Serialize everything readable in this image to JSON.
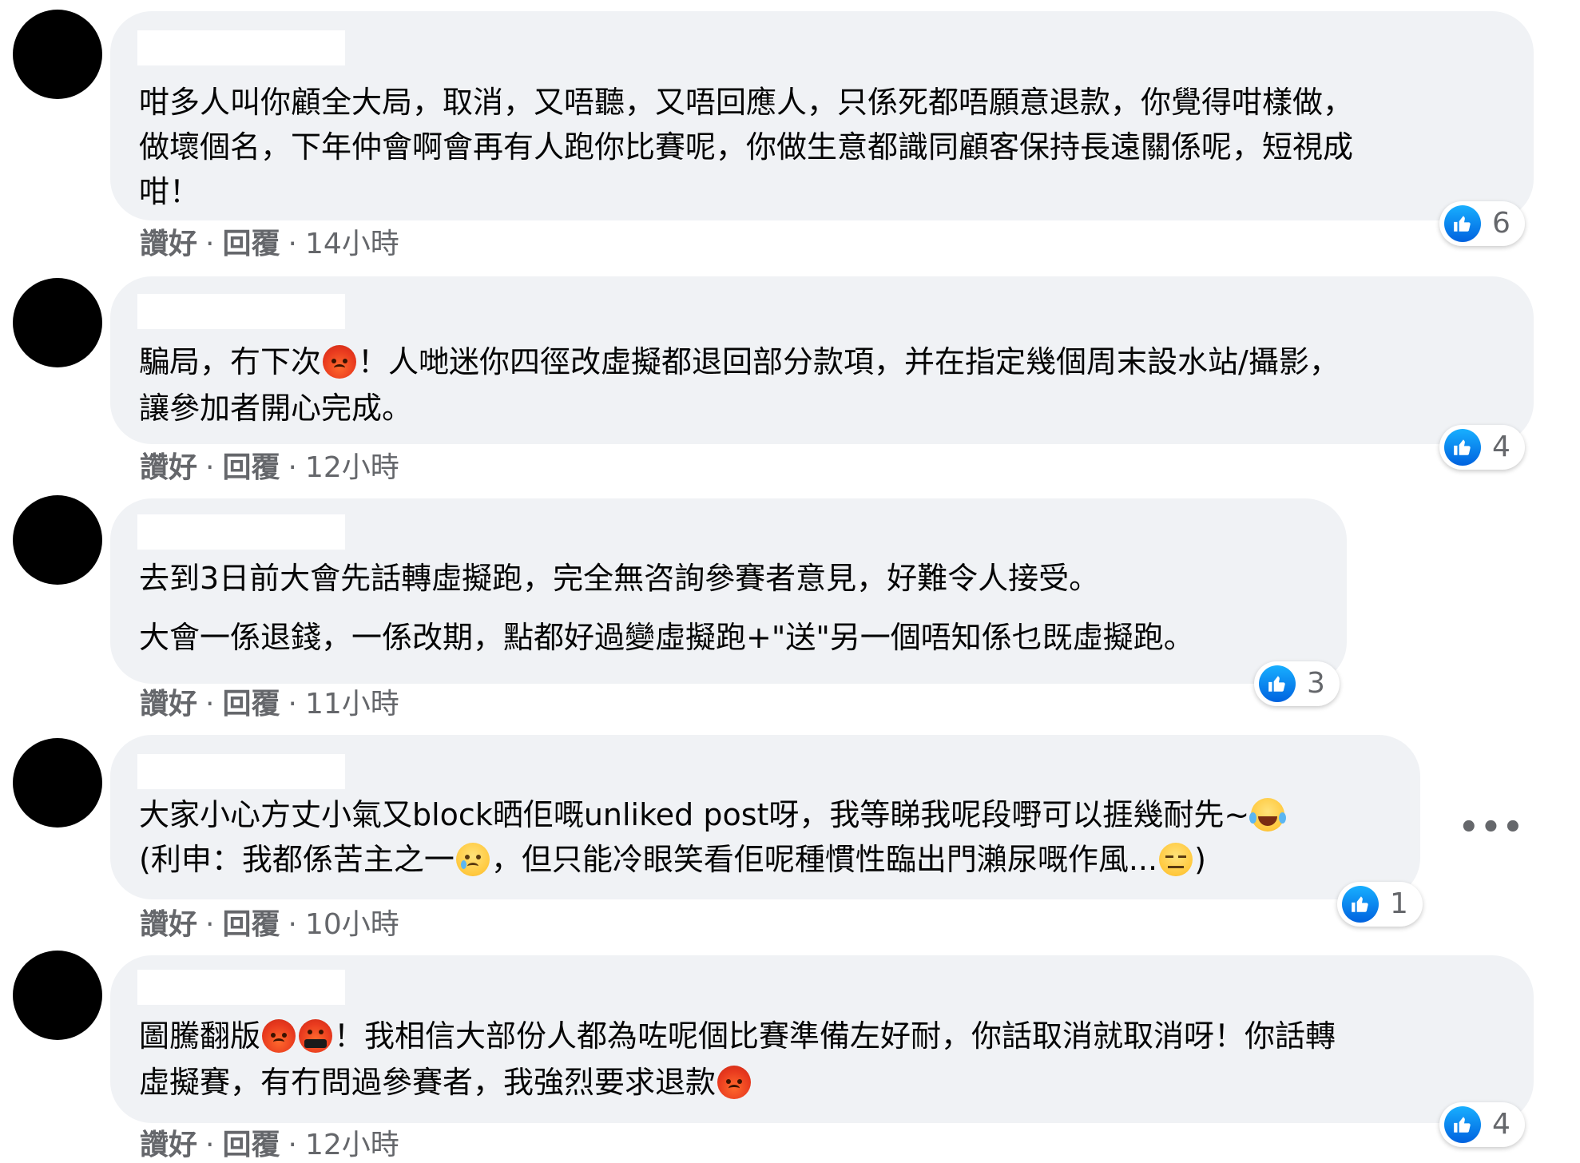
{
  "comments": [
    {
      "lines": [
        [
          {
            "t": "咁多人叫你顧全大局，取消，又唔聽，又唔回應人，只係死都唔願意退款，你覺得咁樣做，"
          }
        ],
        [
          {
            "t": "做壞個名，下年仲會啊會再有人跑你比賽呢，你做生意都識同顧客保持長遠關係呢，短視成"
          }
        ],
        [
          {
            "t": "咁！"
          }
        ]
      ],
      "actions": {
        "like": "讚好",
        "reply": "回覆",
        "time": "14小時"
      },
      "reaction_count": "6"
    },
    {
      "lines": [
        [
          {
            "t": "騙局，冇下次"
          },
          {
            "e": "angry-face"
          },
          {
            "t": "！人哋迷你四徑改虛擬都退回部分款項，并在指定幾個周末設水站/攝影，"
          }
        ],
        [
          {
            "t": "讓參加者開心完成。"
          }
        ]
      ],
      "actions": {
        "like": "讚好",
        "reply": "回覆",
        "time": "12小時"
      },
      "reaction_count": "4"
    },
    {
      "paragraphs": [
        "去到3日前大會先話轉虛擬跑，完全無咨詢參賽者意見，好難令人接受。",
        "大會一係退錢，一係改期，點都好過變虛擬跑+\"送\"另一個唔知係乜既虛擬跑。"
      ],
      "actions": {
        "like": "讚好",
        "reply": "回覆",
        "time": "11小時"
      },
      "reaction_count": "3"
    },
    {
      "lines": [
        [
          {
            "t": "大家小心方丈小氣又block晒佢嘅unliked post呀，我等睇我呢段嘢可以捱幾耐先~"
          },
          {
            "e": "laughing-face"
          }
        ],
        [
          {
            "t": "(利申：我都係苦主之一"
          },
          {
            "e": "sad-tear-face"
          },
          {
            "t": "，但只能冷眼笑看佢呢種慣性臨出門瀨尿嘅作風..."
          },
          {
            "e": "expressionless-face"
          },
          {
            "t": ")"
          }
        ]
      ],
      "actions": {
        "like": "讚好",
        "reply": "回覆",
        "time": "10小時"
      },
      "reaction_count": "1",
      "more_icon": "•••"
    },
    {
      "lines": [
        [
          {
            "t": "圖騰翻版"
          },
          {
            "e": "angry-face"
          },
          {
            "e": "cursing-face"
          },
          {
            "t": "！我相信大部份人都為咗呢個比賽準備左好耐，你話取消就取消呀！你話轉"
          }
        ],
        [
          {
            "t": "虛擬賽，有冇問過參賽者，我強烈要求退款"
          },
          {
            "e": "angry-face"
          }
        ]
      ],
      "actions": {
        "like": "讚好",
        "reply": "回覆",
        "time": "12小時"
      },
      "reaction_count": "4"
    }
  ],
  "colors": {
    "bubble": "#f0f2f5",
    "meta_text": "#65676b",
    "like_blue": "#1877f2"
  },
  "icons": {
    "like": "thumbs-up-icon",
    "more": "more-options-icon",
    "avatar": "avatar"
  }
}
